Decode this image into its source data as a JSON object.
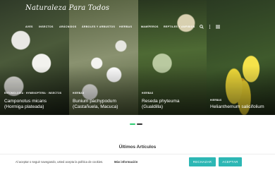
{
  "site": {
    "logo_text": "Naturaleza Para Todos"
  },
  "nav": {
    "items": [
      {
        "label": "AVES"
      },
      {
        "label": "INSECTOS"
      },
      {
        "label": "ARÁCNIDOS"
      },
      {
        "label": "ÁRBOLES Y ARBUSTOS"
      },
      {
        "label": "HIERBAS"
      },
      {
        "label": "MAMÍFEROS"
      },
      {
        "label": "REPTILES Y ANFIBIOS"
      }
    ],
    "icons": [
      "search-icon",
      "more-vertical-icon",
      "menu-icon"
    ]
  },
  "slides": [
    {
      "category": "ENTOMOLOGÍA · HYMENOPTERA · INSECTOS",
      "title_line1": "Camponotus micans",
      "title_line2": "(Hormiga plateada)"
    },
    {
      "category": "HIERBAS",
      "title_line1": "Bunium pachypodum",
      "title_line2": "(Castañuela, Macuca)"
    },
    {
      "category": "HIERBAS",
      "title_line1": "Reseda phyteuma",
      "title_line2": "(Gualdilla)"
    },
    {
      "category": "HIERBAS",
      "title_line1": "Helianthemum salicifolium",
      "title_line2": ""
    }
  ],
  "slider": {
    "active_index": 0,
    "count": 2,
    "active_color": "#2ecc71",
    "inactive_color": "#333333"
  },
  "section": {
    "title": "Últimos Artículos"
  },
  "cookie": {
    "text": "Al aceptar o seguir navegando, usted acepta la política de cookies.",
    "more_label": "Más información",
    "reject_label": "RECHAZAR",
    "accept_label": "ACEPTAR",
    "button_color": "#2db7b4"
  }
}
